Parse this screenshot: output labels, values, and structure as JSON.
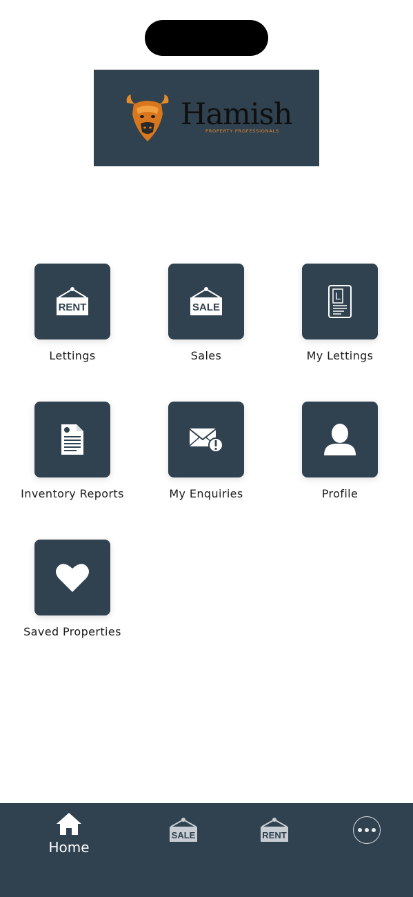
{
  "brand": {
    "name": "Hamish",
    "tagline": "PROPERTY PROFESSIONALS",
    "accent_color": "#e48a2a",
    "panel_color": "#30414f"
  },
  "menu": [
    {
      "label": "Lettings",
      "icon": "rent-sign-icon"
    },
    {
      "label": "Sales",
      "icon": "sale-sign-icon"
    },
    {
      "label": "My Lettings",
      "icon": "lettings-document-icon"
    },
    {
      "label": "Inventory Reports",
      "icon": "report-document-icon"
    },
    {
      "label": "My Enquiries",
      "icon": "envelope-alert-icon"
    },
    {
      "label": "Profile",
      "icon": "user-icon"
    },
    {
      "label": "Saved Properties",
      "icon": "heart-icon"
    }
  ],
  "signs": {
    "rent": "RENT",
    "sale": "SALE",
    "doc_letter": "L"
  },
  "bottom_nav": {
    "home_label": "Home",
    "sale_label": "SALE",
    "rent_label": "RENT",
    "more_icon": "more-dots-icon"
  }
}
